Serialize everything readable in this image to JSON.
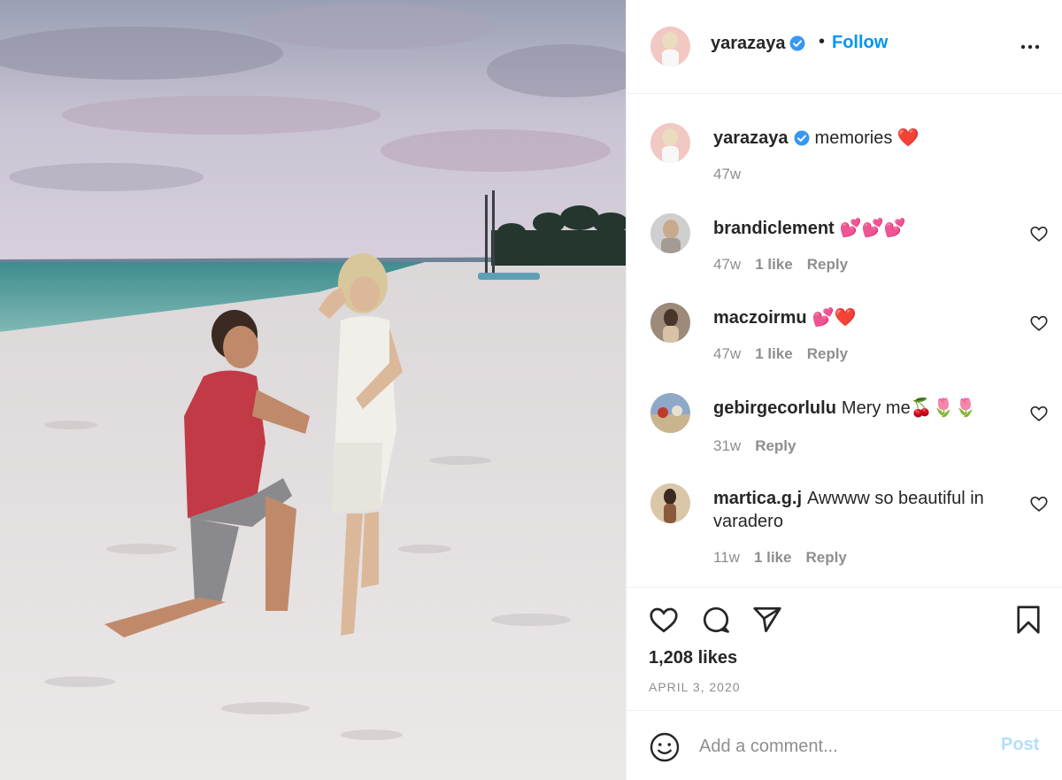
{
  "post": {
    "author": "yarazaya",
    "follow_label": "Follow",
    "dot": "•",
    "more_icon": "more-icon"
  },
  "comments": [
    {
      "username": "yarazaya",
      "text": "memories ❤️",
      "time": "47w",
      "likes": "",
      "reply": ""
    },
    {
      "username": "brandiclement",
      "text": "💕💕💕",
      "time": "47w",
      "likes": "1 like",
      "reply": "Reply"
    },
    {
      "username": "maczoirmu",
      "text": "💕❤️",
      "time": "47w",
      "likes": "1 like",
      "reply": "Reply"
    },
    {
      "username": "gebirgecorlulu",
      "text": "Mery me🍒🌷🌷",
      "time": "31w",
      "likes": "",
      "reply": "Reply"
    },
    {
      "username": "martica.g.j",
      "text": "Awwww so beautiful in varadero",
      "time": "11w",
      "likes": "1 like",
      "reply": "Reply"
    }
  ],
  "footer": {
    "likes": "1,208 likes",
    "date": "APRIL 3, 2020",
    "comment_placeholder": "Add a comment...",
    "post_label": "Post"
  },
  "colors": {
    "accent": "#0095f6",
    "post_disabled": "#b2dffc",
    "muted": "#8e8e8e"
  }
}
